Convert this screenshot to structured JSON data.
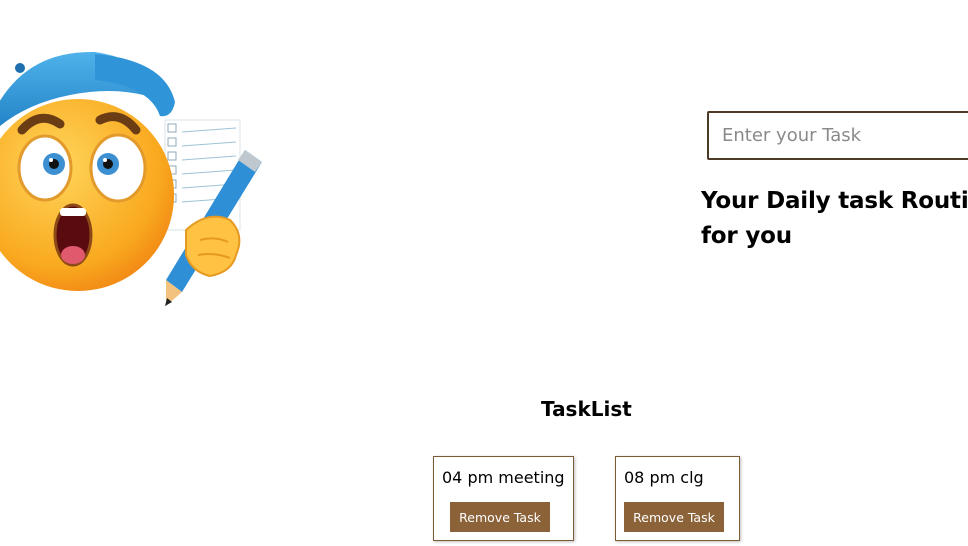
{
  "hero": {
    "icon": "shocked-emoji-with-pencil-and-checklist-icon"
  },
  "task_input": {
    "placeholder": "Enter your Task",
    "value": ""
  },
  "headline": {
    "line1": "Your Daily task Routine",
    "line2": "for you"
  },
  "tasklist": {
    "title": "TaskList",
    "tasks": [
      {
        "text": "04 pm meeting",
        "button_label": "Remove Task"
      },
      {
        "text": "08 pm clg",
        "button_label": "Remove Task"
      }
    ]
  },
  "colors": {
    "accent": "#8c6239",
    "input_border": "#4e3b27",
    "card_border": "#7a5a37"
  }
}
